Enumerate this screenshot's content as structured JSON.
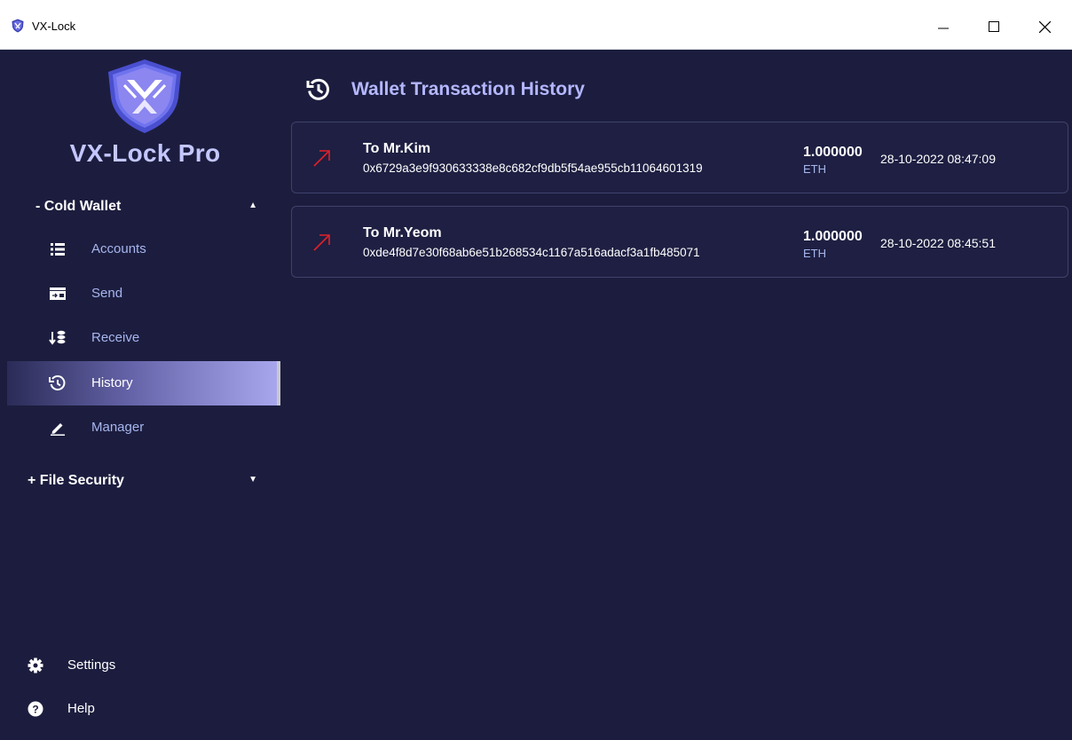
{
  "window": {
    "title": "VX-Lock"
  },
  "sidebar": {
    "brand": "VX-Lock Pro",
    "groups": [
      {
        "label": "- Cold Wallet",
        "expanded": true
      },
      {
        "label": "+ File Security",
        "expanded": false
      }
    ],
    "items": [
      {
        "label": "Accounts",
        "icon": "list-icon"
      },
      {
        "label": "Send",
        "icon": "wallet-send-icon"
      },
      {
        "label": "Receive",
        "icon": "receive-coins-icon"
      },
      {
        "label": "History",
        "icon": "history-icon",
        "active": true
      },
      {
        "label": "Manager",
        "icon": "pen-icon"
      }
    ],
    "bottom": [
      {
        "label": "Settings",
        "icon": "gear-icon"
      },
      {
        "label": "Help",
        "icon": "help-icon"
      }
    ]
  },
  "main": {
    "title": "Wallet Transaction History",
    "transactions": [
      {
        "name": "To Mr.Kim",
        "hash": "0x6729a3e9f930633338e8c682cf9db5f54ae955cb11064601319",
        "amount": "1.000000",
        "unit": "ETH",
        "date": "28-10-2022 08:47:09",
        "direction": "outgoing"
      },
      {
        "name": "To Mr.Yeom",
        "hash": "0xde4f8d7e30f68ab6e51b268534c1167a516adacf3a1fb485071",
        "amount": "1.000000",
        "unit": "ETH",
        "date": "28-10-2022 08:45:51",
        "direction": "outgoing"
      }
    ]
  },
  "colors": {
    "background": "#1c1d3e",
    "accent": "#b4b7ff",
    "outgoing_arrow": "#e0202a",
    "card_border": "#3f416a"
  }
}
